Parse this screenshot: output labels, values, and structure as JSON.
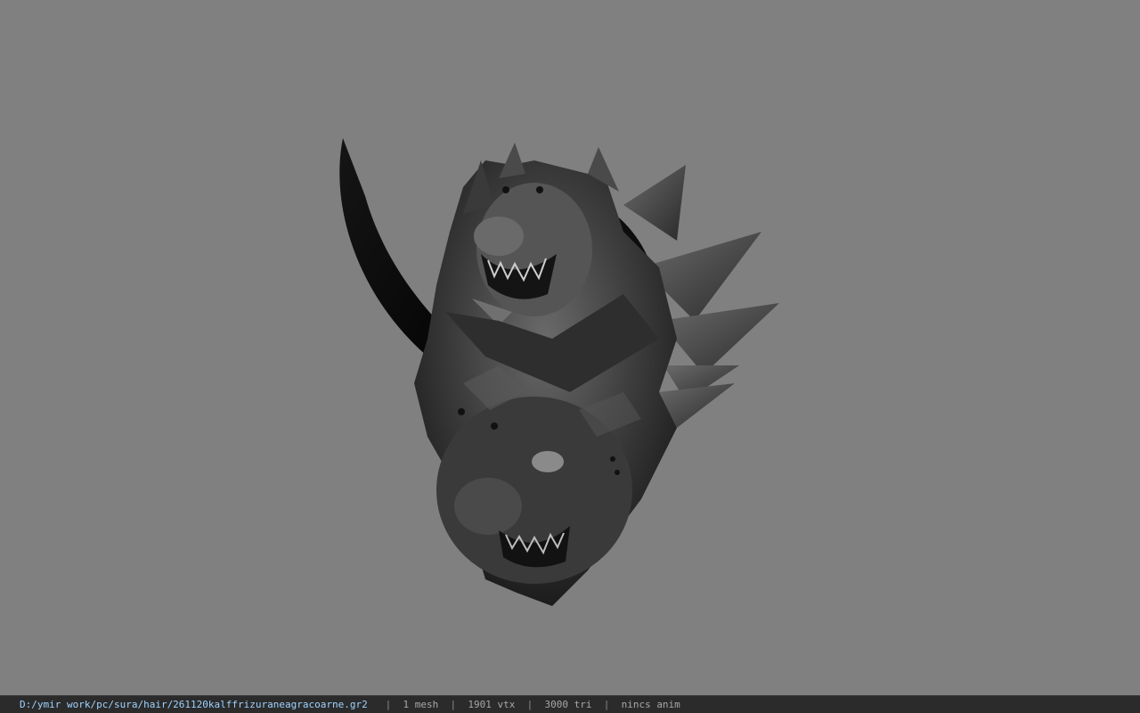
{
  "viewer": {
    "background_color": "#808080",
    "model_name": "model-viewport"
  },
  "statusbar": {
    "path": "D:/ymir work/pc/sura/hair/261120kalffrizuraneagracoarne.gr2",
    "separator": "|",
    "mesh_count": "1 mesh",
    "vertex_count": "1901 vtx",
    "triangle_count": "3000 tri",
    "anim_status": "nincs anim"
  }
}
